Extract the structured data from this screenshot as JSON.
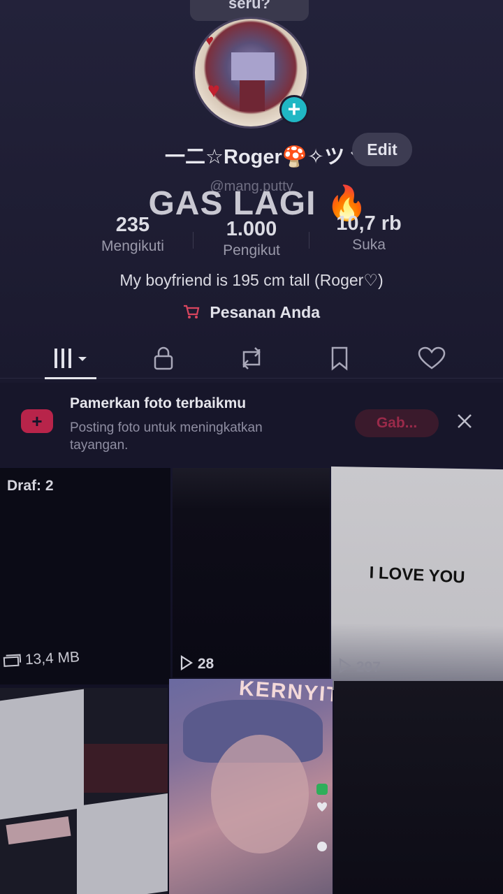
{
  "top_pill": {
    "label": "seru?"
  },
  "profile": {
    "display_name": "一二☆Roger🍄✧ツ",
    "username": "@mang.putty",
    "edit_label": "Edit",
    "overlay_text": "GAS LAGI 🔥"
  },
  "stats": [
    {
      "value": "235",
      "label": "Mengikuti"
    },
    {
      "value": "1.000",
      "label": "Pengikut"
    },
    {
      "value": "10,7 rb",
      "label": "Suka"
    }
  ],
  "bio": "My boyfriend is 195 cm tall (Roger♡)",
  "orders_label": "Pesanan Anda",
  "tabs": [
    {
      "icon": "grid-icon"
    },
    {
      "icon": "lock-icon"
    },
    {
      "icon": "repost-icon"
    },
    {
      "icon": "bookmark-icon"
    },
    {
      "icon": "heart-icon"
    }
  ],
  "promo": {
    "title": "Pamerkan foto terbaikmu",
    "subtitle": "Posting foto untuk meningkatkan tayangan.",
    "button_label": "Gab...",
    "close_icon": "close-icon"
  },
  "grid": {
    "draft_label": "Draf: 2",
    "draft_size": "13,4 MB",
    "video2_views": "28",
    "video3_views": "297",
    "video3_caption": "I LOVE YOU",
    "video5_caption": "KERNYIT"
  },
  "colors": {
    "accent": "#d8455e",
    "badge": "#20b7c4",
    "background": "#1c1b30"
  }
}
